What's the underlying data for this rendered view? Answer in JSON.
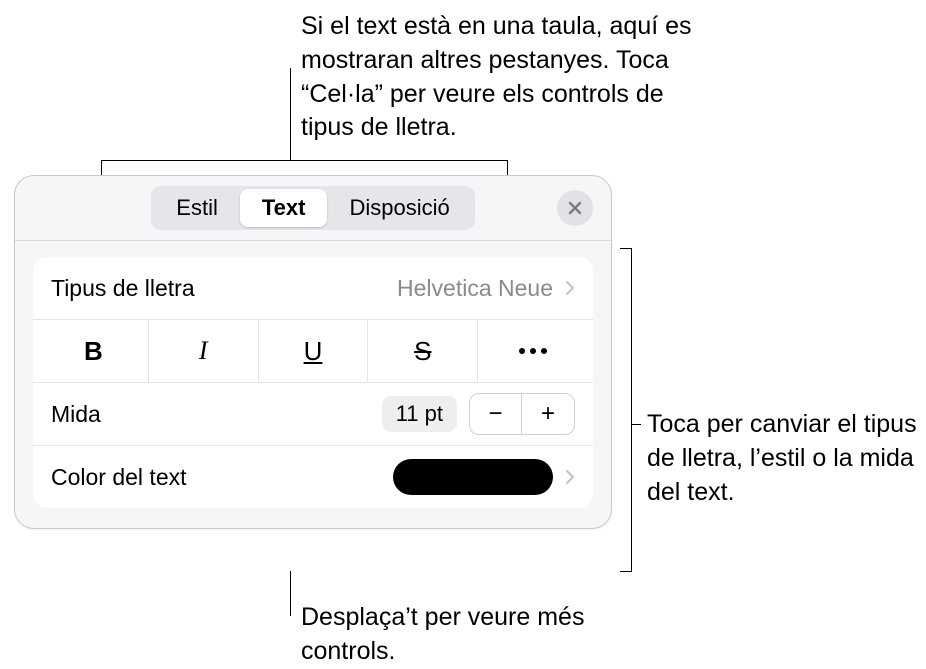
{
  "callouts": {
    "top": "Si el text està en una taula, aquí es mostraran altres pestanyes. Toca “Cel·la” per veure els controls de tipus de lletra.",
    "right": "Toca per canviar el tipus de lletra, l’estil o la mida del text.",
    "bottom": "Desplaça’t per veure més controls."
  },
  "tabs": {
    "style": "Estil",
    "text": "Text",
    "layout": "Disposició",
    "active": "text"
  },
  "rows": {
    "font": {
      "label": "Tipus de lletra",
      "value": "Helvetica Neue"
    },
    "size": {
      "label": "Mida",
      "value": "11 pt"
    },
    "color": {
      "label": "Color del text",
      "swatch": "#000000"
    }
  },
  "style_buttons": {
    "bold": "B",
    "italic": "I",
    "underline": "U",
    "strike": "S"
  },
  "stepper": {
    "minus": "−",
    "plus": "+"
  }
}
